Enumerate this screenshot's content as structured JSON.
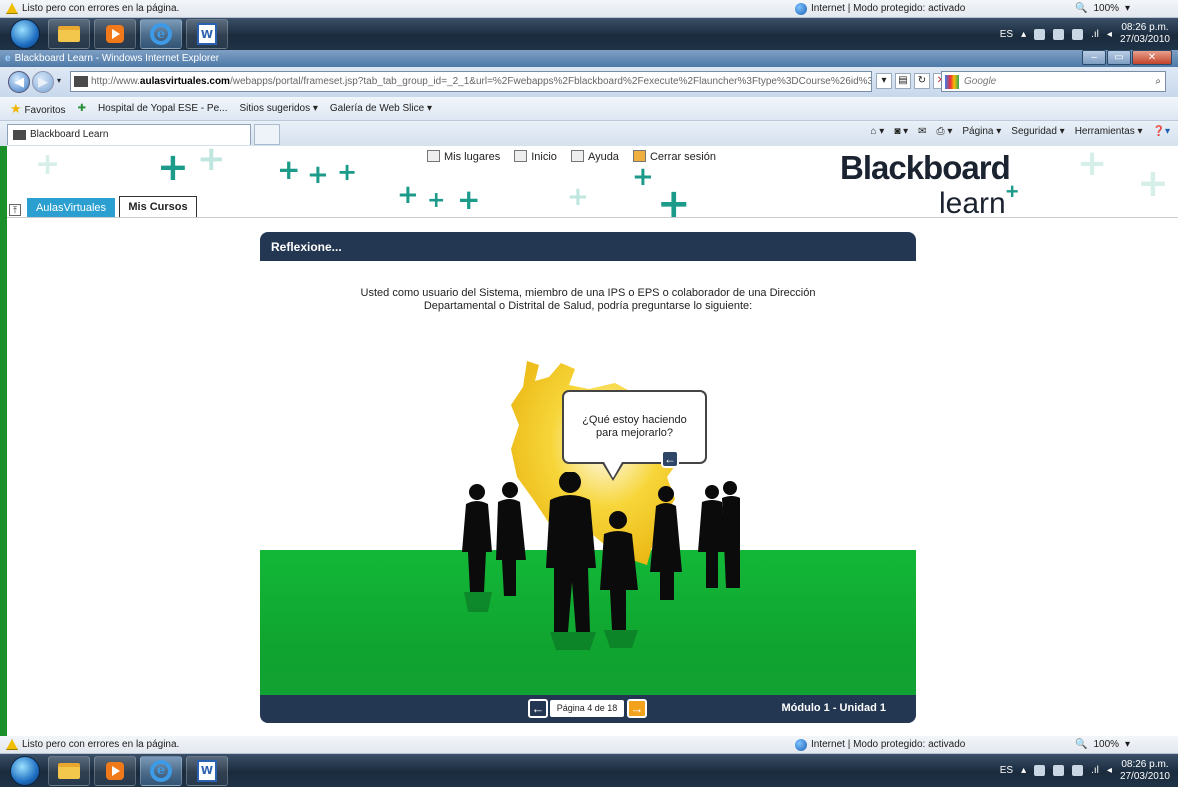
{
  "status_bar": {
    "message": "Listo pero con errores en la página.",
    "zone": "Internet | Modo protegido: activado",
    "zoom": "100%"
  },
  "taskbar": {
    "lang": "ES",
    "time": "08:26 p.m.",
    "date": "27/03/2010"
  },
  "window": {
    "title": "Blackboard Learn - Windows Internet Explorer",
    "minimize": "–",
    "maximize": "▭",
    "close": "✕"
  },
  "address_bar": {
    "prefix": "http://www.",
    "domain": "aulasvirtuales.com",
    "path": "/webapps/portal/frameset.jsp?tab_tab_group_id=_2_1&url=%2Fwebapps%2Fblackboard%2Fexecute%2Flauncher%3Ftype%3DCourse%26id%3D_1(",
    "search_placeholder": "Google"
  },
  "favorites_bar": {
    "favorites": "Favoritos",
    "item1": "Hospital de Yopal ESE - Pe...",
    "item2": "Sitios sugeridos ▾",
    "item3": "Galería de Web Slice ▾"
  },
  "tabs": {
    "active": "Blackboard Learn"
  },
  "command_bar": {
    "pagina": "Página ▾",
    "seguridad": "Seguridad ▾",
    "herramientas": "Herramientas ▾"
  },
  "blackboard": {
    "top_links": [
      "Mis lugares",
      "Inicio",
      "Ayuda",
      "Cerrar sesión"
    ],
    "logo_line1": "Blackboard",
    "logo_line2": "learn",
    "tab_aulas": "AulasVirtuales",
    "tab_cursos": "Mis Cursos"
  },
  "module": {
    "title": "Reflexione...",
    "intro_line1": "Usted como usuario del Sistema, miembro de una IPS o EPS o colaborador de una Dirección",
    "intro_line2": "Departamental o Distrital de Salud, podría preguntarse lo siguiente:",
    "bubble_line1": "¿Qué estoy haciendo",
    "bubble_line2": "para mejorarlo?",
    "page_indicator": "Página 4 de 18",
    "module_label": "Módulo 1 - Unidad 1"
  },
  "colors": {
    "header_navy": "#243752",
    "green": "#13b838",
    "next_orange": "#f3a21c",
    "teal_accent": "#1c9a8a",
    "map_yellow": "#f2c614"
  }
}
